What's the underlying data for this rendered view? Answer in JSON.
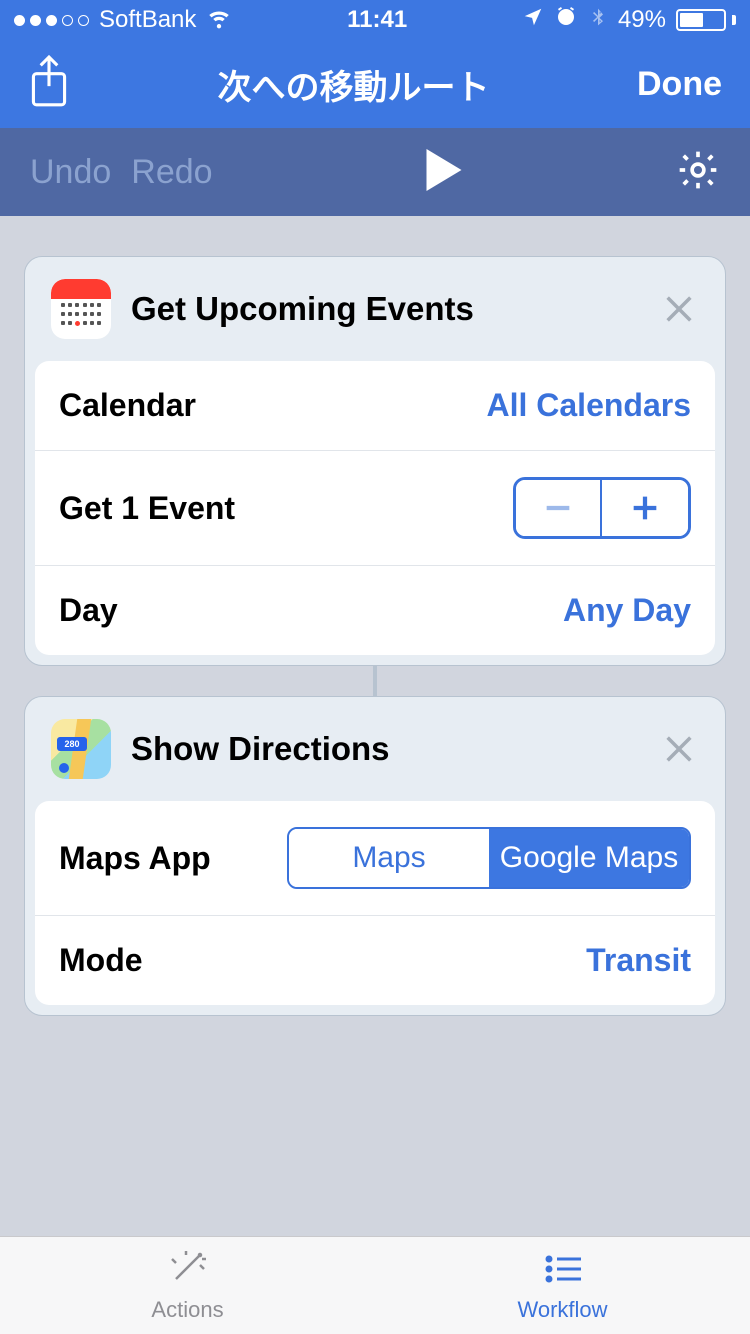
{
  "status": {
    "carrier": "SoftBank",
    "time": "11:41",
    "battery_pct": "49%"
  },
  "nav": {
    "title": "次への移動ルート",
    "done": "Done"
  },
  "toolbar": {
    "undo": "Undo",
    "redo": "Redo"
  },
  "card1": {
    "title": "Get Upcoming Events",
    "rows": {
      "calendar_label": "Calendar",
      "calendar_value": "All Calendars",
      "events_label": "Get 1 Event",
      "day_label": "Day",
      "day_value": "Any Day"
    }
  },
  "card2": {
    "title": "Show Directions",
    "maps_sign": "280",
    "rows": {
      "mapsapp_label": "Maps App",
      "seg_maps": "Maps",
      "seg_gmaps": "Google Maps",
      "mode_label": "Mode",
      "mode_value": "Transit"
    }
  },
  "tabs": {
    "actions": "Actions",
    "workflow": "Workflow"
  }
}
